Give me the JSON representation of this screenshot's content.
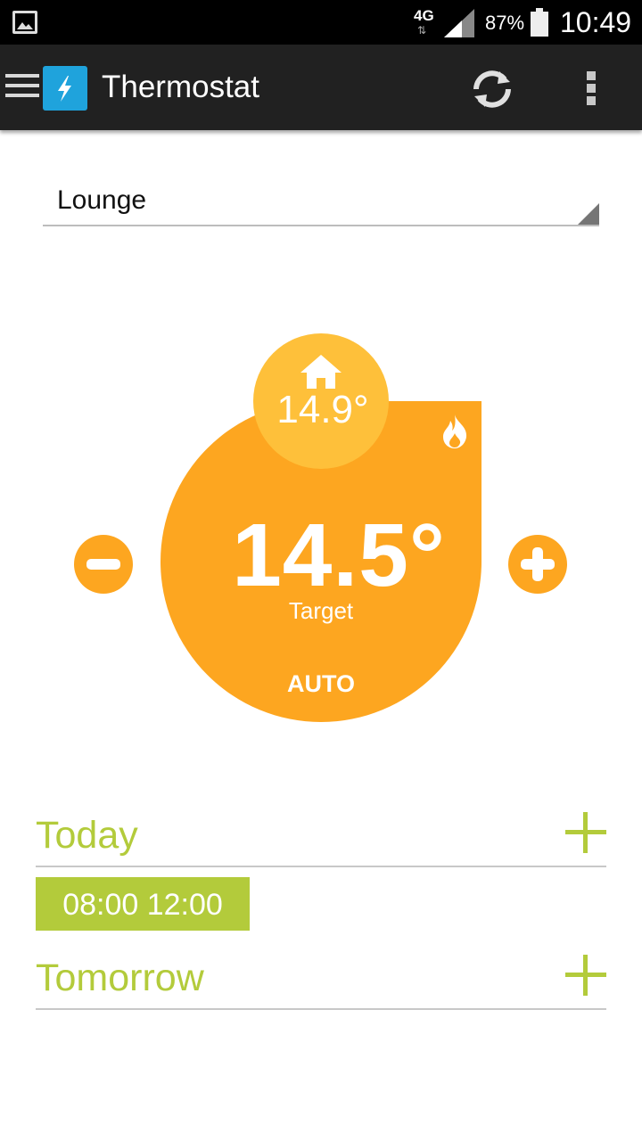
{
  "status_bar": {
    "network_type": "4G",
    "battery_percent": "87%",
    "time": "10:49",
    "icons": [
      "gallery-icon",
      "network-arrows-icon",
      "signal-icon",
      "battery-icon"
    ]
  },
  "action_bar": {
    "title": "Thermostat",
    "icons": [
      "menu-icon",
      "lightning-icon",
      "refresh-icon",
      "overflow-menu-icon"
    ]
  },
  "room_selector": {
    "selected": "Lounge"
  },
  "thermostat": {
    "current_temp": "14.9°",
    "target_temp": "14.5°",
    "target_label": "Target",
    "mode": "AUTO",
    "heating_active": true,
    "colors": {
      "dial": "#fda620",
      "current_bubble": "#fec03a",
      "button": "#fda620"
    }
  },
  "schedule": {
    "accent_color": "#b3cb3b",
    "days": [
      {
        "label": "Today",
        "slots": [
          "08:00 12:00"
        ]
      },
      {
        "label": "Tomorrow",
        "slots": []
      }
    ]
  }
}
